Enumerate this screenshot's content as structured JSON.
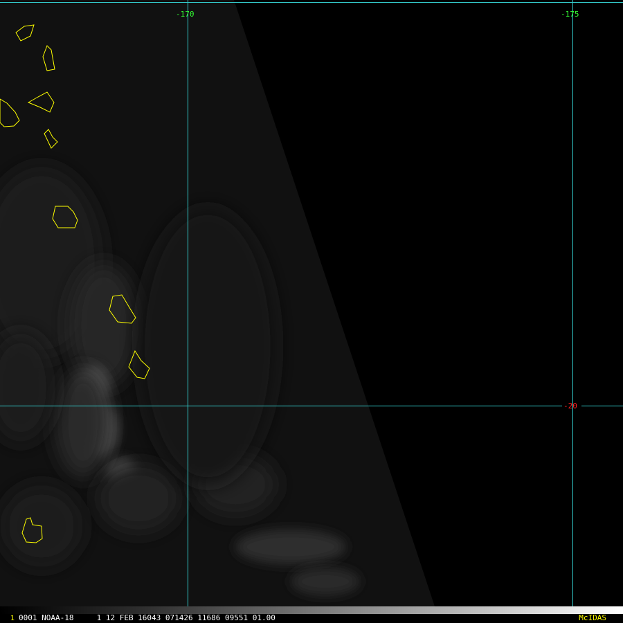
{
  "map": {
    "grid": {
      "lon_labels": [
        "-170",
        "-175"
      ],
      "lat_labels": [
        "-20"
      ],
      "line_color": "#33cccc"
    },
    "colors": {
      "coastline": "#ffff00",
      "lon_label": "#33ff33",
      "lat_label": "#ff2222",
      "background": "#000000"
    }
  },
  "status_bar": {
    "frame": "1",
    "text": "0001 NOAA-18     1 12 FEB 16043 071426 11686 09551 01.00",
    "brand": "McIDAS"
  }
}
